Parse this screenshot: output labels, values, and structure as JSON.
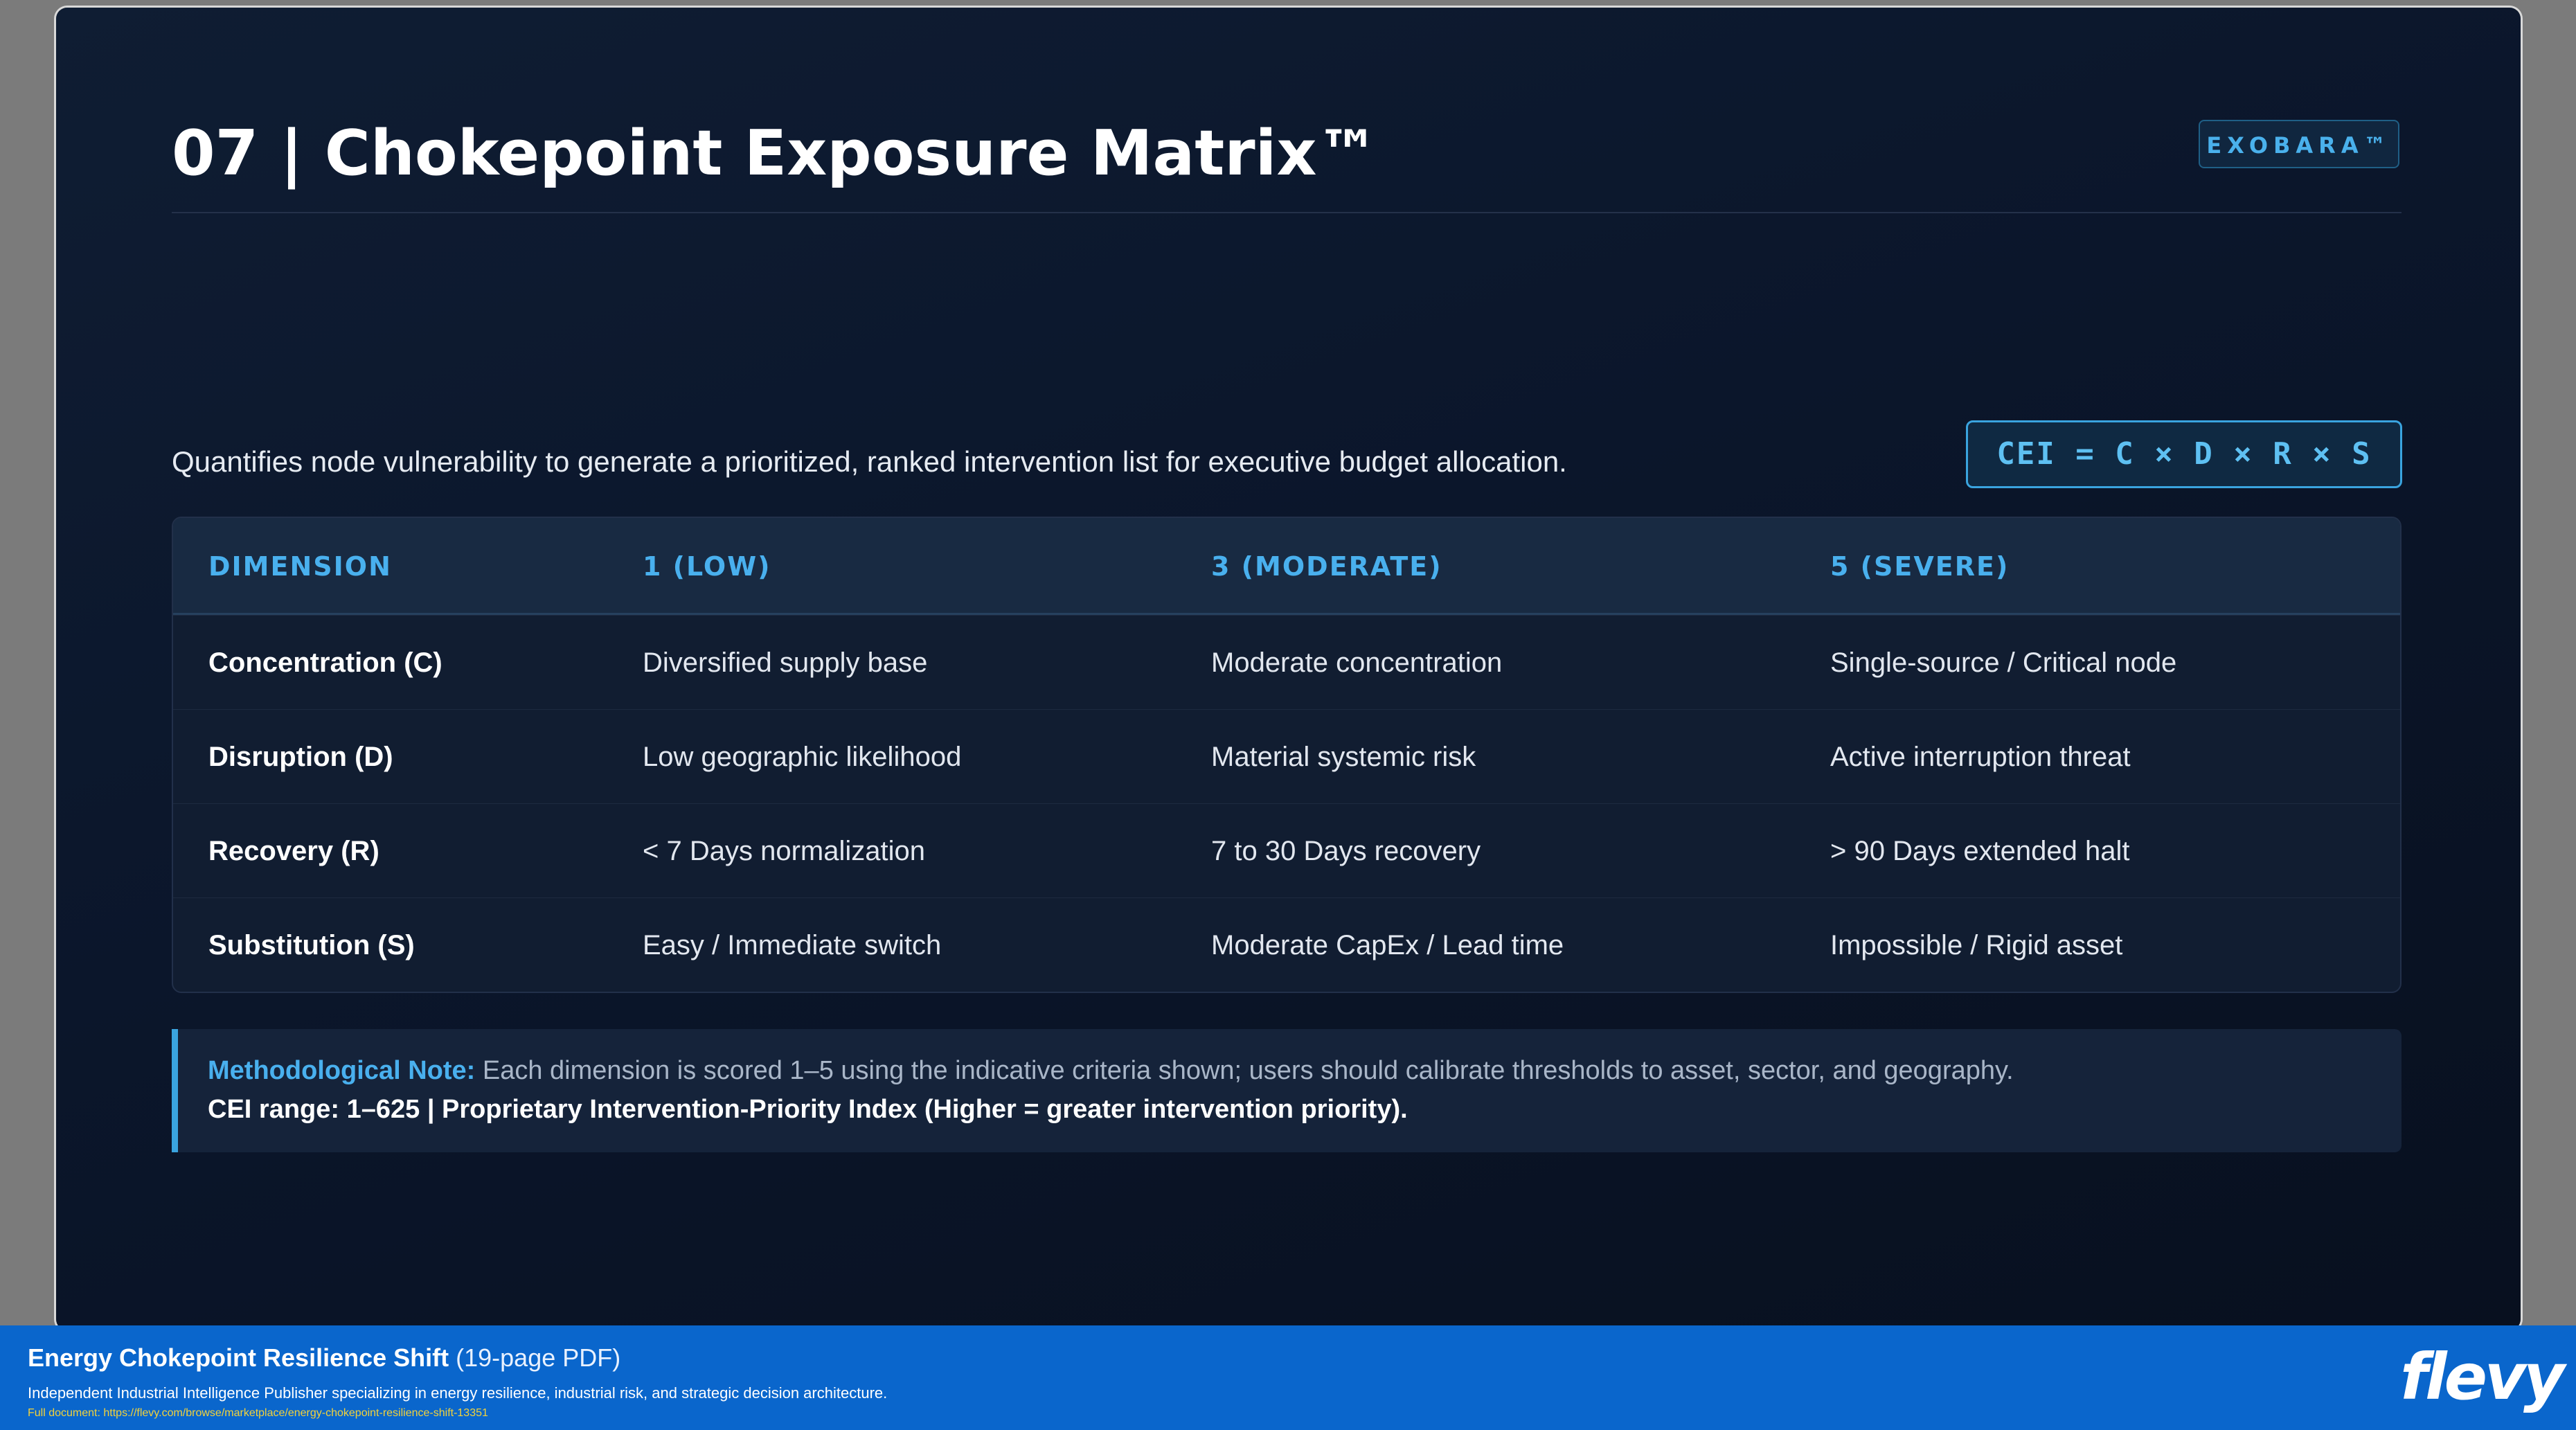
{
  "slide": {
    "title": "07 | Chokepoint Exposure Matrix™",
    "brand_badge": "EXOBARA™",
    "subtitle": "Quantifies node vulnerability to generate a prioritized, ranked intervention list for executive budget allocation.",
    "formula": "CEI = C × D × R × S"
  },
  "matrix": {
    "headers": [
      "DIMENSION",
      "1 (LOW)",
      "3 (MODERATE)",
      "5 (SEVERE)"
    ],
    "rows": [
      {
        "dimension": "Concentration (C)",
        "low": "Diversified supply base",
        "moderate": "Moderate concentration",
        "severe": "Single-source / Critical node"
      },
      {
        "dimension": "Disruption (D)",
        "low": "Low geographic likelihood",
        "moderate": "Material systemic risk",
        "severe": "Active interruption threat"
      },
      {
        "dimension": "Recovery (R)",
        "low": "< 7 Days normalization",
        "moderate": "7 to 30 Days recovery",
        "severe": "> 90 Days extended halt"
      },
      {
        "dimension": "Substitution (S)",
        "low": "Easy / Immediate switch",
        "moderate": "Moderate CapEx / Lead time",
        "severe": "Impossible / Rigid asset"
      }
    ]
  },
  "note": {
    "label": "Methodological Note:",
    "text": " Each dimension is scored 1–5 using the indicative criteria shown; users should calibrate thresholds to asset, sector, and geography.",
    "range": "CEI range: 1–625 | Proprietary Intervention-Priority Index (Higher = greater intervention priority)."
  },
  "footer": {
    "doc_title": "Energy Chokepoint Resilience Shift",
    "doc_pages": " (19-page PDF)",
    "description": "Independent Industrial Intelligence Publisher specializing in energy resilience, industrial risk, and strategic decision architecture.",
    "url": "Full document: https://flevy.com/browse/marketplace/energy-chokepoint-resilience-shift-13351",
    "logo": "flevy"
  },
  "colors": {
    "accent": "#49b0ee",
    "slide_background": "#0b162b",
    "footer_background": "#0a66cc",
    "footer_url": "#f3d23a"
  }
}
